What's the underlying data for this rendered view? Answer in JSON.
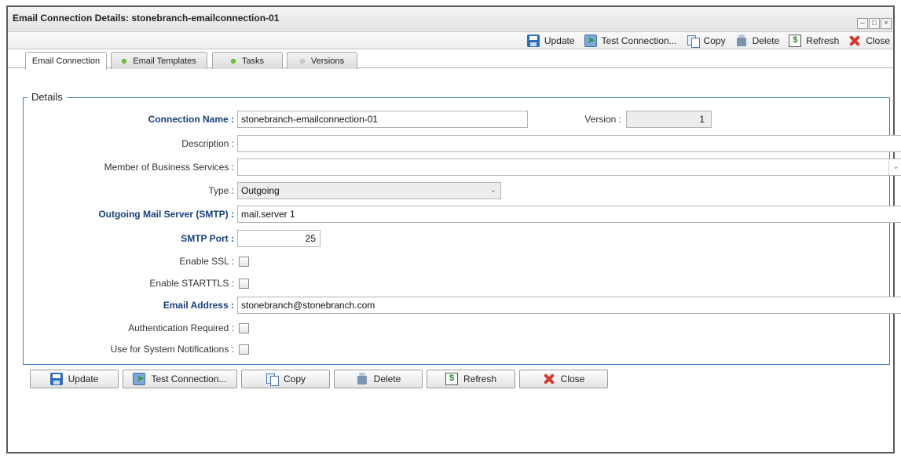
{
  "window": {
    "title": "Email Connection Details: stonebranch-emailconnection-01",
    "controls": [
      "minimize-icon",
      "maximize-icon",
      "close-icon"
    ]
  },
  "toolbar": {
    "update": "Update",
    "test": "Test Connection...",
    "copy": "Copy",
    "delete": "Delete",
    "refresh": "Refresh",
    "close": "Close"
  },
  "tabs": [
    {
      "label": "Email Connection",
      "state": "active"
    },
    {
      "label": "Email Templates",
      "status_color": "#6fcf2f"
    },
    {
      "label": "Tasks",
      "status_color": "#6fcf2f"
    },
    {
      "label": "Versions",
      "status_color": "#cfcfcf"
    }
  ],
  "details": {
    "legend": "Details",
    "connection_name_label": "Connection Name :",
    "connection_name": "stonebranch-emailconnection-01",
    "version_label": "Version :",
    "version": "1",
    "description_label": "Description :",
    "description": "",
    "business_services_label": "Member of Business Services :",
    "business_services": "",
    "type_label": "Type :",
    "type": "Outgoing",
    "smtp_server_label": "Outgoing Mail Server (SMTP) :",
    "smtp_server": "mail.server 1",
    "smtp_port_label": "SMTP Port :",
    "smtp_port": "25",
    "enable_ssl_label": "Enable SSL :",
    "enable_starttls_label": "Enable STARTTLS :",
    "email_address_label": "Email Address :",
    "email_address": "stonebranch@stonebranch.com",
    "auth_required_label": "Authentication Required :",
    "system_notifications_label": "Use for System Notifications :"
  },
  "buttons": {
    "update": "Update",
    "test": "Test Connection...",
    "copy": "Copy",
    "delete": "Delete",
    "refresh": "Refresh",
    "close": "Close"
  },
  "colors": {
    "required_label": "#15407a",
    "fieldset_border": "#3f7cc4",
    "status_green": "#6fcf2f"
  }
}
